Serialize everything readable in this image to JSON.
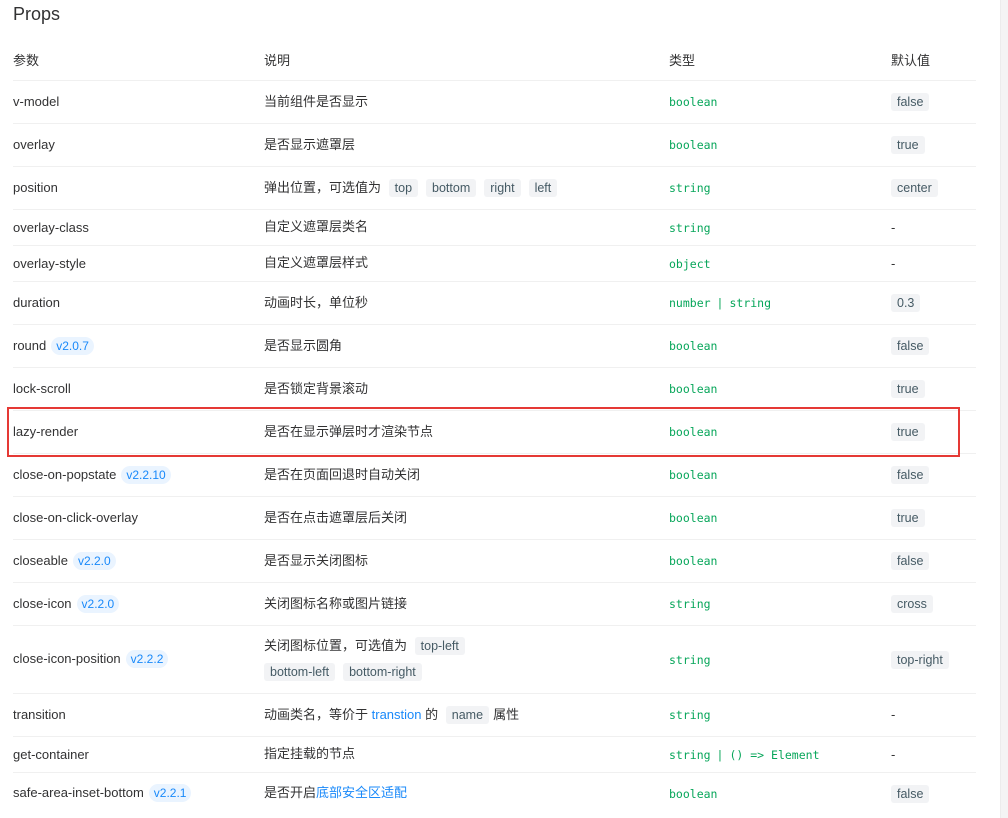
{
  "title": "Props",
  "headers": [
    "参数",
    "说明",
    "类型",
    "默认值"
  ],
  "rows": {
    "r0": {
      "name": "v-model",
      "desc": "当前组件是否显示",
      "type": "boolean",
      "default": "false"
    },
    "r1": {
      "name": "overlay",
      "desc": "是否显示遮罩层",
      "type": "boolean",
      "default": "true"
    },
    "r2": {
      "name": "position",
      "desc": "弹出位置，可选值为",
      "opts": [
        "top",
        "bottom",
        "right",
        "left"
      ],
      "type": "string",
      "default": "center"
    },
    "r3": {
      "name": "overlay-class",
      "desc": "自定义遮罩层类名",
      "type": "string",
      "default": "-"
    },
    "r4": {
      "name": "overlay-style",
      "desc": "自定义遮罩层样式",
      "type": "object",
      "default": "-"
    },
    "r5": {
      "name": "duration",
      "desc": "动画时长，单位秒",
      "type": "number",
      "type2": "string",
      "default": "0.3"
    },
    "r6": {
      "name": "round",
      "version": "v2.0.7",
      "desc": "是否显示圆角",
      "type": "boolean",
      "default": "false"
    },
    "r7": {
      "name": "lock-scroll",
      "desc": "是否锁定背景滚动",
      "type": "boolean",
      "default": "true"
    },
    "r8": {
      "name": "lazy-render",
      "desc": "是否在显示弹层时才渲染节点",
      "type": "boolean",
      "default": "true"
    },
    "r9": {
      "name": "close-on-popstate",
      "version": "v2.2.10",
      "desc": "是否在页面回退时自动关闭",
      "type": "boolean",
      "default": "false"
    },
    "r10": {
      "name": "close-on-click-overlay",
      "desc": "是否在点击遮罩层后关闭",
      "type": "boolean",
      "default": "true"
    },
    "r11": {
      "name": "closeable",
      "version": "v2.2.0",
      "desc": "是否显示关闭图标",
      "type": "boolean",
      "default": "false"
    },
    "r12": {
      "name": "close-icon",
      "version": "v2.2.0",
      "desc": "关闭图标名称或图片链接",
      "type": "string",
      "default": "cross"
    },
    "r13": {
      "name": "close-icon-position",
      "version": "v2.2.2",
      "desc": "关闭图标位置，可选值为",
      "opts": [
        "top-left",
        "bottom-left",
        "bottom-right"
      ],
      "type": "string",
      "default": "top-right"
    },
    "r14": {
      "name": "transition",
      "desc_pre": "动画类名，等价于",
      "desc_link": "transtion",
      "desc_mid": "的",
      "desc_code": "name",
      "desc_post": "属性",
      "type": "string",
      "default": "-"
    },
    "r15": {
      "name": "get-container",
      "desc": "指定挂载的节点",
      "type": "string",
      "type2": "() => Element",
      "default": "-"
    },
    "r16": {
      "name": "safe-area-inset-bottom",
      "version": "v2.2.1",
      "desc_pre": "是否开启",
      "desc_link": "底部安全区适配",
      "type": "boolean",
      "default": "false"
    }
  },
  "type_separator": "|",
  "colors": {
    "accent": "#1989fa",
    "type_green": "#07a65a",
    "highlight_red": "#e53935"
  }
}
